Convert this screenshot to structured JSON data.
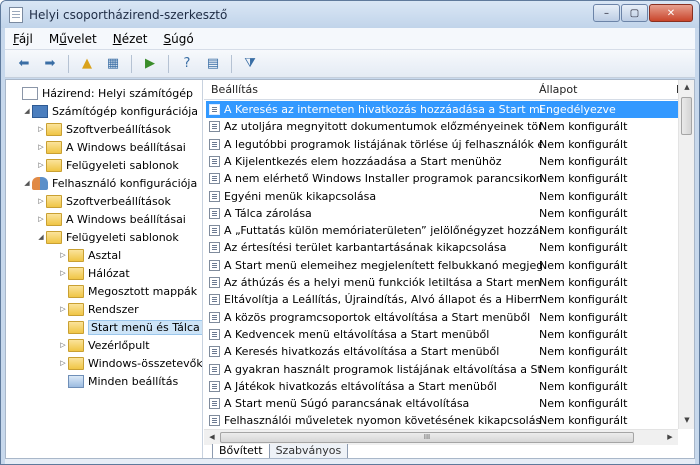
{
  "window": {
    "title": "Helyi csoportházirend-szerkesztő",
    "buttons": {
      "minimize": "–",
      "maximize": "▢",
      "close": "✕"
    }
  },
  "menubar": [
    {
      "label": "Fájl",
      "accel": "F",
      "rest": "ájl"
    },
    {
      "label": "Művelet",
      "pre": "M",
      "accel": "ű",
      "rest": "velet"
    },
    {
      "label": "Nézet",
      "accel": "N",
      "rest": "ézet"
    },
    {
      "label": "Súgó",
      "accel": "S",
      "rest": "úgó"
    }
  ],
  "toolbar": {
    "icons": [
      "back-icon",
      "forward-icon",
      "up-folder-icon",
      "show-hide-tree-icon",
      "export-list-icon",
      "help-icon",
      "properties-icon",
      "filter-icon"
    ]
  },
  "tree": [
    {
      "label": "Házirend: Helyi számítógép",
      "icon": "doc",
      "level": 0,
      "expander": ""
    },
    {
      "label": "Számítógép konfigurációja",
      "icon": "computer",
      "level": 1,
      "expander": "◢"
    },
    {
      "label": "Szoftverbeállítások",
      "icon": "folder",
      "level": 2,
      "expander": "▷"
    },
    {
      "label": "A Windows beállításai",
      "icon": "folder",
      "level": 2,
      "expander": "▷"
    },
    {
      "label": "Felügyeleti sablonok",
      "icon": "folder",
      "level": 2,
      "expander": "▷"
    },
    {
      "label": "Felhasználó konfigurációja",
      "icon": "users",
      "level": 1,
      "expander": "◢"
    },
    {
      "label": "Szoftverbeállítások",
      "icon": "folder",
      "level": 2,
      "expander": "▷"
    },
    {
      "label": "A Windows beállításai",
      "icon": "folder",
      "level": 2,
      "expander": "▷"
    },
    {
      "label": "Felügyeleti sablonok",
      "icon": "folder",
      "level": 2,
      "expander": "◢"
    },
    {
      "label": "Asztal",
      "icon": "folder",
      "level": 3,
      "expander": "▷"
    },
    {
      "label": "Hálózat",
      "icon": "folder",
      "level": 3,
      "expander": "▷"
    },
    {
      "label": "Megosztott mappák",
      "icon": "folder",
      "level": 3,
      "expander": ""
    },
    {
      "label": "Rendszer",
      "icon": "folder",
      "level": 3,
      "expander": "▷"
    },
    {
      "label": "Start menü és Tálca",
      "icon": "folder",
      "level": 3,
      "expander": "",
      "selected": true
    },
    {
      "label": "Vezérlőpult",
      "icon": "folder",
      "level": 3,
      "expander": "▷"
    },
    {
      "label": "Windows-összetevők",
      "icon": "folder",
      "level": 3,
      "expander": "▷"
    },
    {
      "label": "Minden beállítás",
      "icon": "gp",
      "level": 3,
      "expander": ""
    }
  ],
  "list": {
    "columns": {
      "setting": "Beállítás",
      "state": "Állapot",
      "comment": "M"
    },
    "rows": [
      {
        "setting": "A Keresés az interneten hivatkozás hozzáadása a Start menü...",
        "state": "Engedélyezve",
        "selected": true
      },
      {
        "setting": "Az utoljára megnyitott dokumentumok előzményeinek törlé...",
        "state": "Nem konfigurált"
      },
      {
        "setting": "A legutóbbi programok listájának törlése új felhasználók ese...",
        "state": "Nem konfigurált"
      },
      {
        "setting": "A Kijelentkezés elem hozzáadása a Start menühöz",
        "state": "Nem konfigurált"
      },
      {
        "setting": "A nem elérhető Windows Installer programok parancsikonja...",
        "state": "Nem konfigurált"
      },
      {
        "setting": "Egyéni menük kikapcsolása",
        "state": "Nem konfigurált"
      },
      {
        "setting": "A Tálca zárolása",
        "state": "Nem konfigurált"
      },
      {
        "setting": "A „Futtatás külön memóriaterületen” jelölőnégyzet hozzáad...",
        "state": "Nem konfigurált"
      },
      {
        "setting": "Az értesítési terület karbantartásának kikapcsolása",
        "state": "Nem konfigurált"
      },
      {
        "setting": "A Start menü elemeihez megjelenített felbukkanó megjegyz...",
        "state": "Nem konfigurált"
      },
      {
        "setting": "Az áthúzás és a helyi menü funkciók letiltása a Start menü es...",
        "state": "Nem konfigurált"
      },
      {
        "setting": "Eltávolítja a Leállítás, Újraindítás, Alvó állapot és a Hibernálá...",
        "state": "Nem konfigurált"
      },
      {
        "setting": "A közös programcsoportok eltávolítása a Start menüből",
        "state": "Nem konfigurált"
      },
      {
        "setting": "A Kedvencek menü eltávolítása a Start menüből",
        "state": "Nem konfigurált"
      },
      {
        "setting": "A Keresés hivatkozás eltávolítása a Start menüből",
        "state": "Nem konfigurált"
      },
      {
        "setting": "A gyakran használt programok listájának eltávolítása a Start ...",
        "state": "Nem konfigurált"
      },
      {
        "setting": "A Játékok hivatkozás eltávolítása a Start menüből",
        "state": "Nem konfigurált"
      },
      {
        "setting": "A Start menü Súgó parancsának eltávolítása",
        "state": "Nem konfigurált"
      },
      {
        "setting": "Felhasználói műveletek nyomon követésének kikapcsolása",
        "state": "Nem konfigurált"
      }
    ],
    "hscroll_grip": "III"
  },
  "tabs": [
    {
      "label": "Bővített",
      "active": true
    },
    {
      "label": "Szabványos",
      "active": false
    }
  ]
}
